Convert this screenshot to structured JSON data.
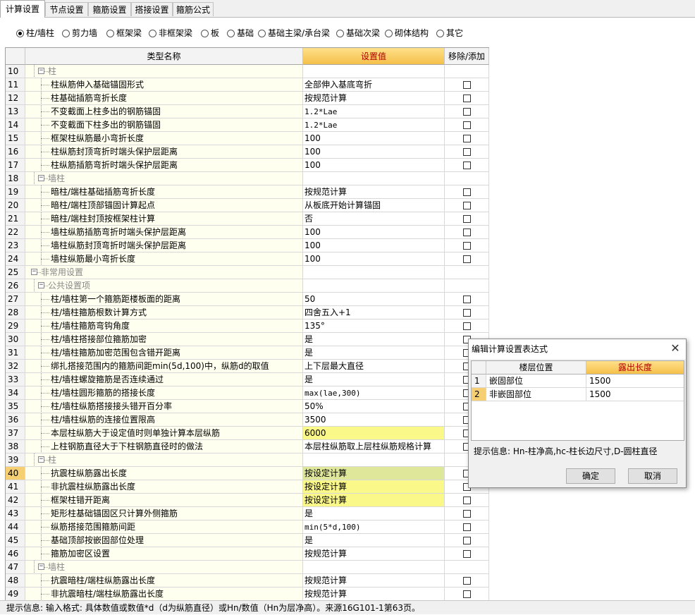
{
  "tabs": [
    {
      "label": "计算设置",
      "active": true
    },
    {
      "label": "节点设置",
      "active": false
    },
    {
      "label": "箍筋设置",
      "active": false
    },
    {
      "label": "搭接设置",
      "active": false
    },
    {
      "label": "箍筋公式",
      "active": false
    }
  ],
  "radios": [
    {
      "label": "柱/墙柱",
      "checked": true
    },
    {
      "label": "剪力墙",
      "checked": false
    },
    {
      "label": "框架梁",
      "checked": false
    },
    {
      "label": "非框架梁",
      "checked": false
    },
    {
      "label": "板",
      "checked": false
    },
    {
      "label": "基础",
      "checked": false
    },
    {
      "label": "基础主梁/承台梁",
      "checked": false
    },
    {
      "label": "基础次梁",
      "checked": false
    },
    {
      "label": "砌体结构",
      "checked": false
    },
    {
      "label": "其它",
      "checked": false
    }
  ],
  "grid": {
    "headers": {
      "type_name": "类型名称",
      "value": "设置值",
      "action": "移除/添加"
    },
    "rows": [
      {
        "num": "10",
        "level": 1,
        "group": true,
        "name": "柱",
        "value": ""
      },
      {
        "num": "11",
        "level": 2,
        "name": "柱纵筋伸入基础锚固形式",
        "value": "全部伸入基底弯折",
        "check": true
      },
      {
        "num": "12",
        "level": 2,
        "name": "柱基础插筋弯折长度",
        "value": "按规范计算",
        "check": true
      },
      {
        "num": "13",
        "level": 2,
        "name": "不变截面上柱多出的钢筋锚固",
        "value": "1.2*Lae",
        "mono": true,
        "check": true
      },
      {
        "num": "14",
        "level": 2,
        "name": "不变截面下柱多出的钢筋锚固",
        "value": "1.2*Lae",
        "mono": true,
        "check": true
      },
      {
        "num": "15",
        "level": 2,
        "name": "框架柱纵筋最小弯折长度",
        "value": "100",
        "check": true
      },
      {
        "num": "16",
        "level": 2,
        "name": "柱纵筋封顶弯折时端头保护层距离",
        "value": "100",
        "check": true
      },
      {
        "num": "17",
        "level": 2,
        "name": "柱纵筋插筋弯折时端头保护层距离",
        "value": "100",
        "check": true
      },
      {
        "num": "18",
        "level": 1,
        "group": true,
        "name": "墙柱",
        "value": ""
      },
      {
        "num": "19",
        "level": 2,
        "name": "暗柱/端柱基础插筋弯折长度",
        "value": "按规范计算",
        "check": true
      },
      {
        "num": "20",
        "level": 2,
        "name": "暗柱/端柱顶部锚固计算起点",
        "value": "从板底开始计算锚固",
        "check": true
      },
      {
        "num": "21",
        "level": 2,
        "name": "暗柱/端柱封顶按框架柱计算",
        "value": "否",
        "check": true
      },
      {
        "num": "22",
        "level": 2,
        "name": "墙柱纵筋插筋弯折时端头保护层距离",
        "value": "100",
        "check": true
      },
      {
        "num": "23",
        "level": 2,
        "name": "墙柱纵筋封顶弯折时端头保护层距离",
        "value": "100",
        "check": true
      },
      {
        "num": "24",
        "level": 2,
        "name": "墙柱纵筋最小弯折长度",
        "value": "100",
        "check": true
      },
      {
        "num": "25",
        "level": 0,
        "group": true,
        "name": "非常用设置",
        "value": ""
      },
      {
        "num": "26",
        "level": 1,
        "group": true,
        "name": "公共设置项",
        "value": ""
      },
      {
        "num": "27",
        "level": 2,
        "name": "柱/墙柱第一个箍筋距楼板面的距离",
        "value": "50",
        "check": true
      },
      {
        "num": "28",
        "level": 2,
        "name": "柱/墙柱箍筋根数计算方式",
        "value": "四舍五入+1",
        "check": true
      },
      {
        "num": "29",
        "level": 2,
        "name": "柱/墙柱箍筋弯钩角度",
        "value": "135°",
        "check": true
      },
      {
        "num": "30",
        "level": 2,
        "name": "柱/墙柱搭接部位箍筋加密",
        "value": "是",
        "check": true
      },
      {
        "num": "31",
        "level": 2,
        "name": "柱/墙柱箍筋加密范围包含错开距离",
        "value": "是",
        "check": true
      },
      {
        "num": "32",
        "level": 2,
        "name": "绑扎搭接范围内的箍筋间距min(5d,100)中，纵筋d的取值",
        "value": "上下层最大直径",
        "check": true
      },
      {
        "num": "33",
        "level": 2,
        "name": "柱/墙柱螺旋箍筋是否连续通过",
        "value": "是",
        "check": true
      },
      {
        "num": "34",
        "level": 2,
        "name": "柱/墙柱圆形箍筋的搭接长度",
        "value": "max(lae,300)",
        "mono": true,
        "check": true
      },
      {
        "num": "35",
        "level": 2,
        "name": "柱/墙柱纵筋搭接接头错开百分率",
        "value": "50%",
        "check": true
      },
      {
        "num": "36",
        "level": 2,
        "name": "柱/墙柱纵筋的连接位置限高",
        "value": "3500",
        "check": true
      },
      {
        "num": "37",
        "level": 2,
        "name": "本层柱纵筋大于设定值时则单独计算本层纵筋",
        "value": "6000",
        "highlight": "yellow",
        "check": true
      },
      {
        "num": "38",
        "level": 2,
        "name": "上柱钢筋直径大于下柱钢筋直径时的做法",
        "value": "本层柱纵筋取上层柱纵筋规格计算",
        "check": true
      },
      {
        "num": "39",
        "level": 1,
        "group": true,
        "name": "柱",
        "value": ""
      },
      {
        "num": "40",
        "level": 2,
        "name": "抗震柱纵筋露出长度",
        "value": "按设定计算",
        "highlight": "green",
        "selected": true,
        "check": true
      },
      {
        "num": "41",
        "level": 2,
        "name": "非抗震柱纵筋露出长度",
        "value": "按设定计算",
        "highlight": "yellow",
        "check": true
      },
      {
        "num": "42",
        "level": 2,
        "name": "框架柱错开距离",
        "value": "按设定计算",
        "highlight": "yellow",
        "check": true
      },
      {
        "num": "43",
        "level": 2,
        "name": "矩形柱基础锚固区只计算外侧箍筋",
        "value": "是",
        "check": true
      },
      {
        "num": "44",
        "level": 2,
        "name": "纵筋搭接范围箍筋间距",
        "value": "min(5*d,100)",
        "mono": true,
        "check": true
      },
      {
        "num": "45",
        "level": 2,
        "name": "基础顶部按嵌固部位处理",
        "value": "是",
        "check": true
      },
      {
        "num": "46",
        "level": 2,
        "name": "箍筋加密区设置",
        "value": "按规范计算",
        "check": true
      },
      {
        "num": "47",
        "level": 1,
        "group": true,
        "name": "墙柱",
        "value": ""
      },
      {
        "num": "48",
        "level": 2,
        "name": "抗震暗柱/端柱纵筋露出长度",
        "value": "按规范计算",
        "check": true
      },
      {
        "num": "49",
        "level": 2,
        "name": "非抗震暗柱/端柱纵筋露出长度",
        "value": "按规范计算",
        "check": true
      }
    ]
  },
  "status_text": "提示信息: 输入格式: 具体数值或数值*d（d为纵筋直径）或Hn/数值（Hn为层净高）。来源16G101-1第63页。",
  "dialog": {
    "title": "编辑计算设置表达式",
    "close": "✕",
    "headers": {
      "position": "楼层位置",
      "length": "露出长度"
    },
    "rows": [
      {
        "num": "1",
        "position": "嵌固部位",
        "length": "1500",
        "selected": false
      },
      {
        "num": "2",
        "position": "非嵌固部位",
        "length": "1500",
        "selected": true
      }
    ],
    "hint": "提示信息: Hn-柱净高,hc-柱长边尺寸,D-圆柱直径",
    "ok": "确定",
    "cancel": "取消"
  },
  "colors": {
    "header_value_bg": "#f5c04a",
    "header_value_text": "#b00000",
    "selected_row_num": "#f7cf73",
    "green_value": "#dfe79a",
    "yellow_value": "#fbf88a",
    "name_bg": "#fffff0"
  }
}
